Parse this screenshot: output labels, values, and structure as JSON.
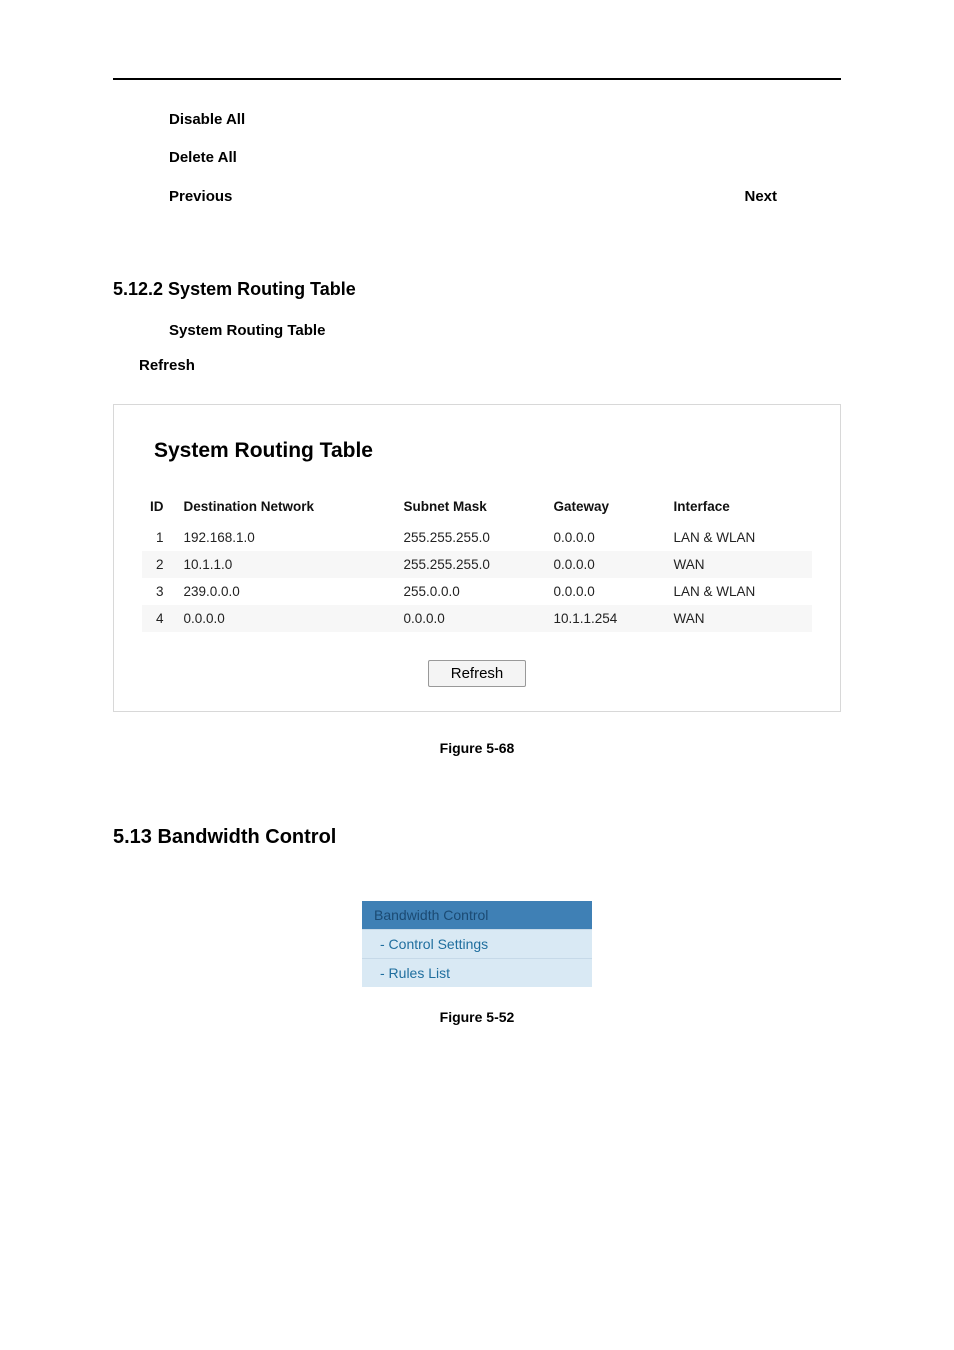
{
  "definitions": {
    "disable_all": "Disable All",
    "delete_all": "Delete All",
    "previous": "Previous",
    "next": "Next"
  },
  "section_5_12_2": {
    "heading": "5.12.2  System Routing Table",
    "para_bold": "System  Routing  Table",
    "refresh_label": "Refresh"
  },
  "panel": {
    "title": "System Routing Table",
    "headers": {
      "id": "ID",
      "dest": "Destination Network",
      "mask": "Subnet Mask",
      "gateway": "Gateway",
      "iface": "Interface"
    },
    "rows": [
      {
        "id": "1",
        "dest": "192.168.1.0",
        "mask": "255.255.255.0",
        "gateway": "0.0.0.0",
        "iface": "LAN & WLAN"
      },
      {
        "id": "2",
        "dest": "10.1.1.0",
        "mask": "255.255.255.0",
        "gateway": "0.0.0.0",
        "iface": "WAN"
      },
      {
        "id": "3",
        "dest": "239.0.0.0",
        "mask": "255.0.0.0",
        "gateway": "0.0.0.0",
        "iface": "LAN & WLAN"
      },
      {
        "id": "4",
        "dest": "0.0.0.0",
        "mask": "0.0.0.0",
        "gateway": "10.1.1.254",
        "iface": "WAN"
      }
    ],
    "refresh_btn": "Refresh",
    "caption": "Figure 5-68"
  },
  "section_5_13": {
    "heading": "5.13  Bandwidth Control"
  },
  "bw_menu": {
    "header": "Bandwidth Control",
    "items": [
      "- Control Settings",
      "- Rules List"
    ],
    "caption": "Figure 5-52"
  }
}
